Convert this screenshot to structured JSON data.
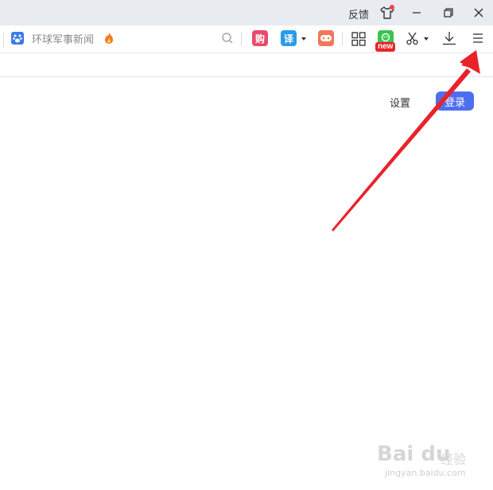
{
  "titlebar": {
    "feedback_label": "反馈",
    "skin_icon": "tshirt-icon",
    "minimize_icon": "minimize-icon",
    "restore_icon": "restore-icon",
    "close_icon": "close-icon"
  },
  "toolbar": {
    "search_placeholder": "环球军事新闻",
    "search_icon": "search-icon",
    "extensions": [
      {
        "name": "shop",
        "glyph": "购"
      },
      {
        "name": "translate",
        "glyph": "译"
      },
      {
        "name": "game",
        "glyph": ""
      },
      {
        "name": "apps",
        "glyph": ""
      },
      {
        "name": "new-extension",
        "badge": "new"
      }
    ],
    "screenshot_icon": "scissors-icon",
    "download_icon": "download-icon",
    "menu_icon": "menu-icon"
  },
  "page": {
    "settings_label": "设置",
    "login_label": "登录"
  },
  "watermark": {
    "logo": "Bai du",
    "text": "经验",
    "url": "jingyan.baidu.com"
  },
  "colors": {
    "titlebar_bg": "#e8ebf0",
    "login_bg": "#4e6ef2",
    "arrow": "#e8232a",
    "new_badge": "#e8242a"
  }
}
